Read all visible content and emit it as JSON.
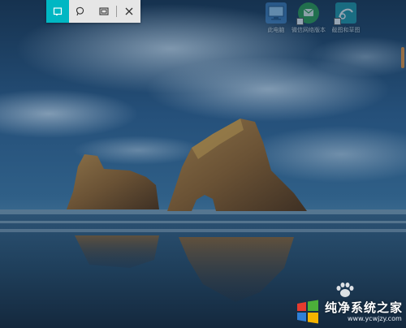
{
  "snip_toolbar": {
    "tools": [
      {
        "icon": "rectangular-snip-icon",
        "active": true
      },
      {
        "icon": "freeform-snip-icon",
        "active": false
      },
      {
        "icon": "fullscreen-snip-icon",
        "active": false
      }
    ],
    "close_icon": "close-icon"
  },
  "desktop": {
    "icons": [
      {
        "label": "此电脑",
        "icon": "computer-icon",
        "color": "#3a79b8"
      },
      {
        "label": "微信网络版本",
        "icon": "wechat-icon",
        "color": "#2aa04a"
      },
      {
        "label": "截图和草图",
        "icon": "snip-sketch-icon",
        "color": "#1c9aa8"
      }
    ]
  },
  "watermark": {
    "title": "纯净系统之家",
    "url": "www.ycwjzy.com"
  }
}
